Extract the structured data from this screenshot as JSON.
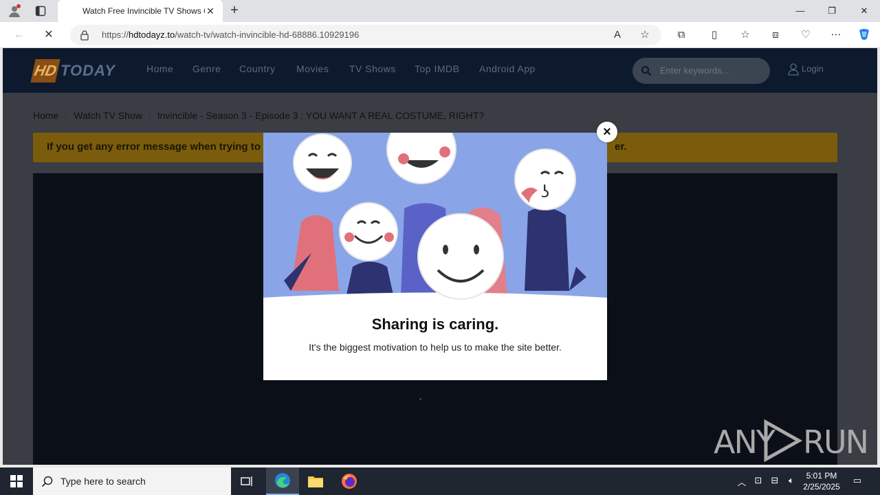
{
  "browser": {
    "tab_title": "Watch Free Invincible TV Shows O",
    "url_host": "hdtodayz.to",
    "url_prefix": "https://",
    "url_path": "/watch-tv/watch-invincible-hd-68886.10929196"
  },
  "site": {
    "logo_hd": "HD",
    "logo_today": "TODAY",
    "nav": [
      "Home",
      "Genre",
      "Country",
      "Movies",
      "TV Shows",
      "Top IMDB",
      "Android App"
    ],
    "search_placeholder": "Enter keywords...",
    "login_label": "Login"
  },
  "breadcrumb": {
    "items": [
      "Home",
      "Watch TV Show",
      "Invincible - Season 3 - Episode 3 : YOU WANT A REAL COSTUME, RIGHT?"
    ],
    "separator": "/"
  },
  "notice": {
    "text_left": "If you get any error message when trying to",
    "text_right": "er."
  },
  "modal": {
    "title": "Sharing is caring.",
    "subtitle": "It's the biggest motivation to help us to make the site better.",
    "close_symbol": "×",
    "illustration_bg": "#8aa4e8"
  },
  "watermark": {
    "text_a": "ANY",
    "text_b": "RUN"
  },
  "taskbar": {
    "search_placeholder": "Type here to search",
    "time": "5:01 PM",
    "date": "2/25/2025"
  },
  "colors": {
    "header_bg": "#0d1a2e",
    "notice_bg": "#7a5c0c",
    "overlay_bg": "#3a3d44"
  }
}
